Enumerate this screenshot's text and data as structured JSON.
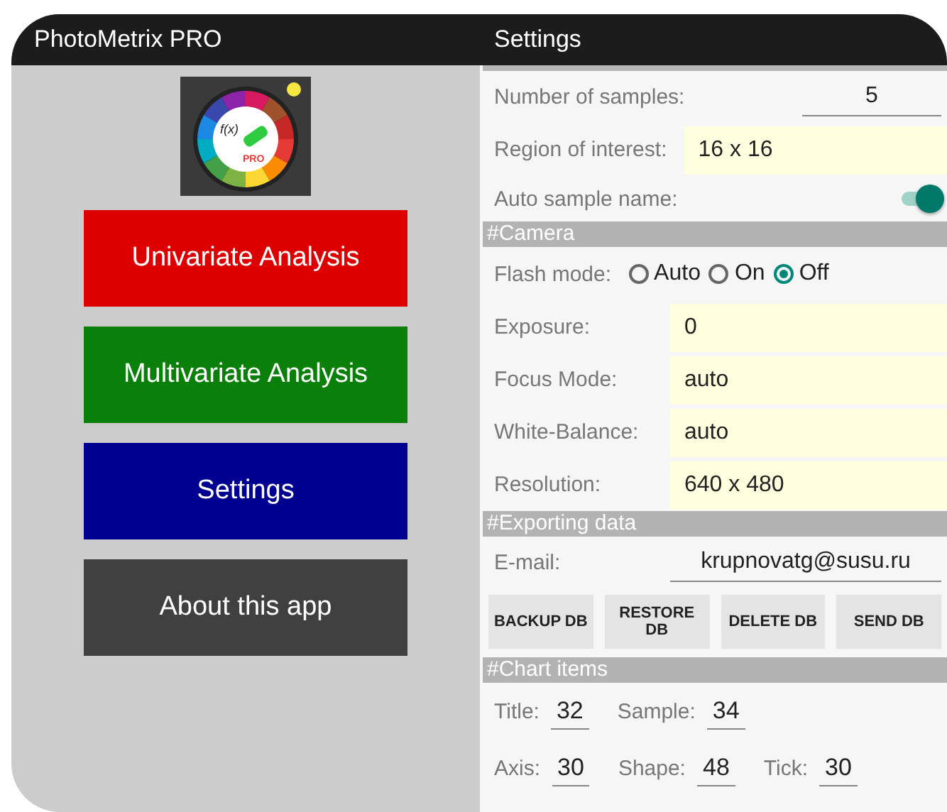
{
  "left_panel": {
    "title": "PhotoMetrix PRO",
    "logo": {
      "formula": "f(x)",
      "badge": "PRO"
    },
    "buttons": [
      {
        "label": "Univariate Analysis",
        "color": "#dd0000"
      },
      {
        "label": "Multivariate Analysis",
        "color": "#0a7f0a"
      },
      {
        "label": "Settings",
        "color": "#000090"
      },
      {
        "label": "About this app",
        "color": "#404040"
      }
    ]
  },
  "settings": {
    "title": "Settings",
    "items": [
      {
        "kind": "underline",
        "label": "Number of samples:",
        "value": "5"
      },
      {
        "kind": "field",
        "label": "Region of interest:",
        "value": "16 x 16"
      },
      {
        "kind": "switch",
        "label": "Auto sample name:",
        "on": true
      },
      {
        "kind": "section",
        "label": "#Camera"
      },
      {
        "kind": "radio",
        "label": "Flash mode:",
        "options": [
          {
            "label": "Auto",
            "selected": false
          },
          {
            "label": "On",
            "selected": false
          },
          {
            "label": "Off",
            "selected": true
          }
        ]
      },
      {
        "kind": "field",
        "label": "Exposure:",
        "value": "0"
      },
      {
        "kind": "field",
        "label": "Focus Mode:",
        "value": "auto"
      },
      {
        "kind": "field",
        "label": "White-Balance:",
        "value": "auto"
      },
      {
        "kind": "field",
        "label": "Resolution:",
        "value": "640 x 480"
      },
      {
        "kind": "section",
        "label": "#Exporting data"
      },
      {
        "kind": "underline",
        "label": "E-mail:",
        "value": "krupnovatg@susu.ru"
      },
      {
        "kind": "buttons",
        "buttons": [
          "BACKUP DB",
          "RESTORE DB",
          "DELETE DB",
          "SEND DB"
        ]
      },
      {
        "kind": "section",
        "label": "#Chart items"
      },
      {
        "kind": "pairs",
        "pairs": [
          {
            "label": "Title:",
            "value": "32"
          },
          {
            "label": "Sample:",
            "value": "34"
          }
        ]
      },
      {
        "kind": "pairs",
        "pairs": [
          {
            "label": "Axis:",
            "value": "30"
          },
          {
            "label": "Shape:",
            "value": "48"
          },
          {
            "label": "Tick:",
            "value": "30"
          }
        ]
      }
    ]
  }
}
